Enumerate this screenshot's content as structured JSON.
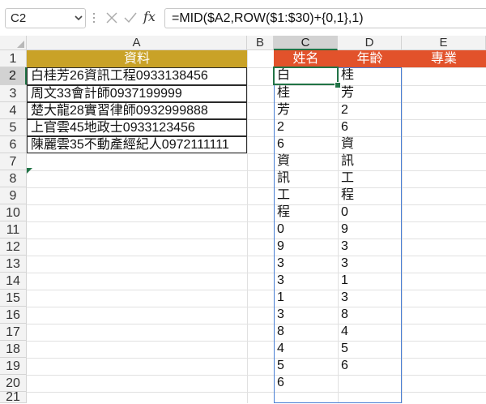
{
  "formula_bar": {
    "name_box": "C2",
    "fx_label": "fx",
    "formula": "=MID($A2,ROW($1:$30)+{0,1},1)"
  },
  "columns": [
    "A",
    "B",
    "C",
    "D",
    "E"
  ],
  "rows": [
    "1",
    "2",
    "3",
    "4",
    "5",
    "6",
    "7",
    "8",
    "9",
    "10",
    "11",
    "12",
    "13",
    "14",
    "15",
    "16",
    "17",
    "18",
    "19",
    "20",
    "21"
  ],
  "headers": {
    "a1": "資料",
    "c1": "姓名",
    "d1": "年齡",
    "e1": "專業"
  },
  "data_a": [
    "白桂芳26資訊工程0933138456",
    "周文33會計師0937199999",
    "楚大龍28實習律師0932999888",
    "上官雲45地政士0933123456",
    "陳麗雲35不動產經紀人0972111111"
  ],
  "spill_c": [
    "白",
    "桂",
    "芳",
    "2",
    "6",
    "資",
    "訊",
    "工",
    "程",
    "0",
    "9",
    "3",
    "3",
    "1",
    "3",
    "8",
    "4",
    "5",
    "6"
  ],
  "spill_d": [
    "桂",
    "芳",
    "2",
    "6",
    "資",
    "訊",
    "工",
    "程",
    "0",
    "9",
    "3",
    "3",
    "1",
    "3",
    "8",
    "4",
    "5",
    "6"
  ],
  "colors": {
    "header_gold": "#c9a227",
    "header_orange": "#e2522b",
    "excel_green": "#217346",
    "spill_border": "#4a7fd4"
  }
}
